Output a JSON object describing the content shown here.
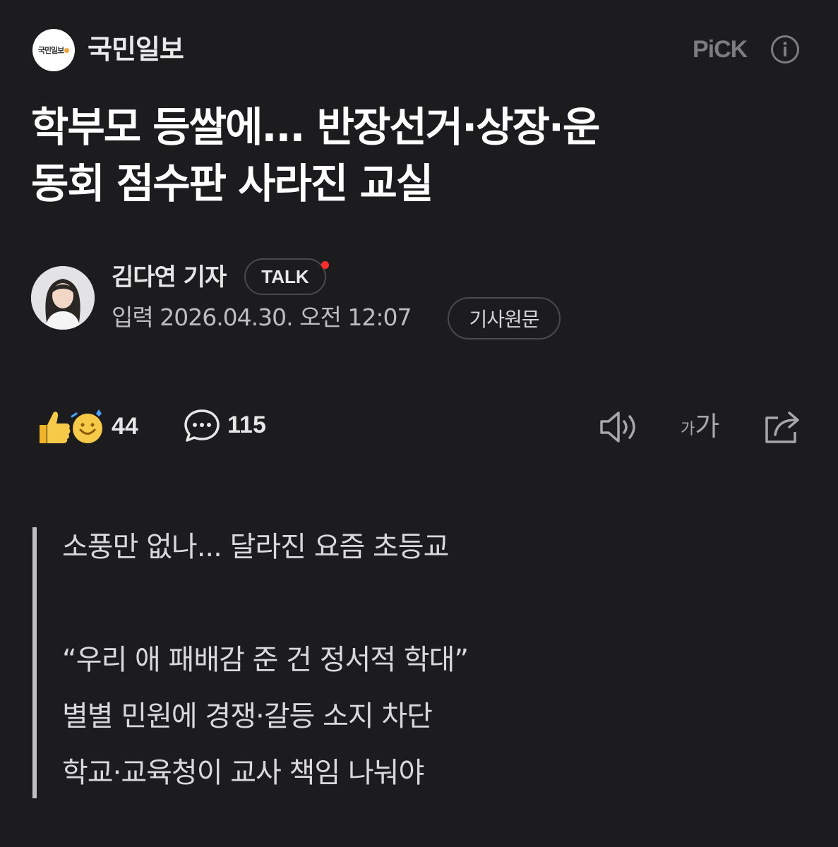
{
  "header": {
    "logo_text": "국민일보",
    "press_name": "국민일보",
    "pick_label": "PiCK",
    "info_icon": "info-icon"
  },
  "article": {
    "headline_line1": "학부모 등쌀에... 반장선거·상장·운",
    "headline_line2": "동회 점수판 사라진 교실"
  },
  "author": {
    "name": "김다연 기자",
    "talk_label": "TALK",
    "date": "입력 2026.04.30. 오전 12:07",
    "original_label": "기사원문"
  },
  "toolbar": {
    "reaction_count": "44",
    "comment_count": "115",
    "fontsize_small": "가",
    "fontsize_large": "가",
    "icons": [
      "thumbs-up-icon",
      "smile-icon",
      "comment-icon",
      "speaker-icon",
      "font-size-icon",
      "share-icon"
    ]
  },
  "summary": {
    "lines": [
      "소풍만 없나... 달라진 요즘 초등교",
      "",
      "“우리 애 패배감 준 건 정서적 학대”",
      "별별 민원에 경쟁·갈등 소지 차단",
      "학교·교육청이 교사 책임 나눠야"
    ]
  },
  "colors": {
    "background": "#1c1c1e",
    "talk_dot": "#ff2d2d",
    "muted_icon": "#a7a7aa"
  }
}
